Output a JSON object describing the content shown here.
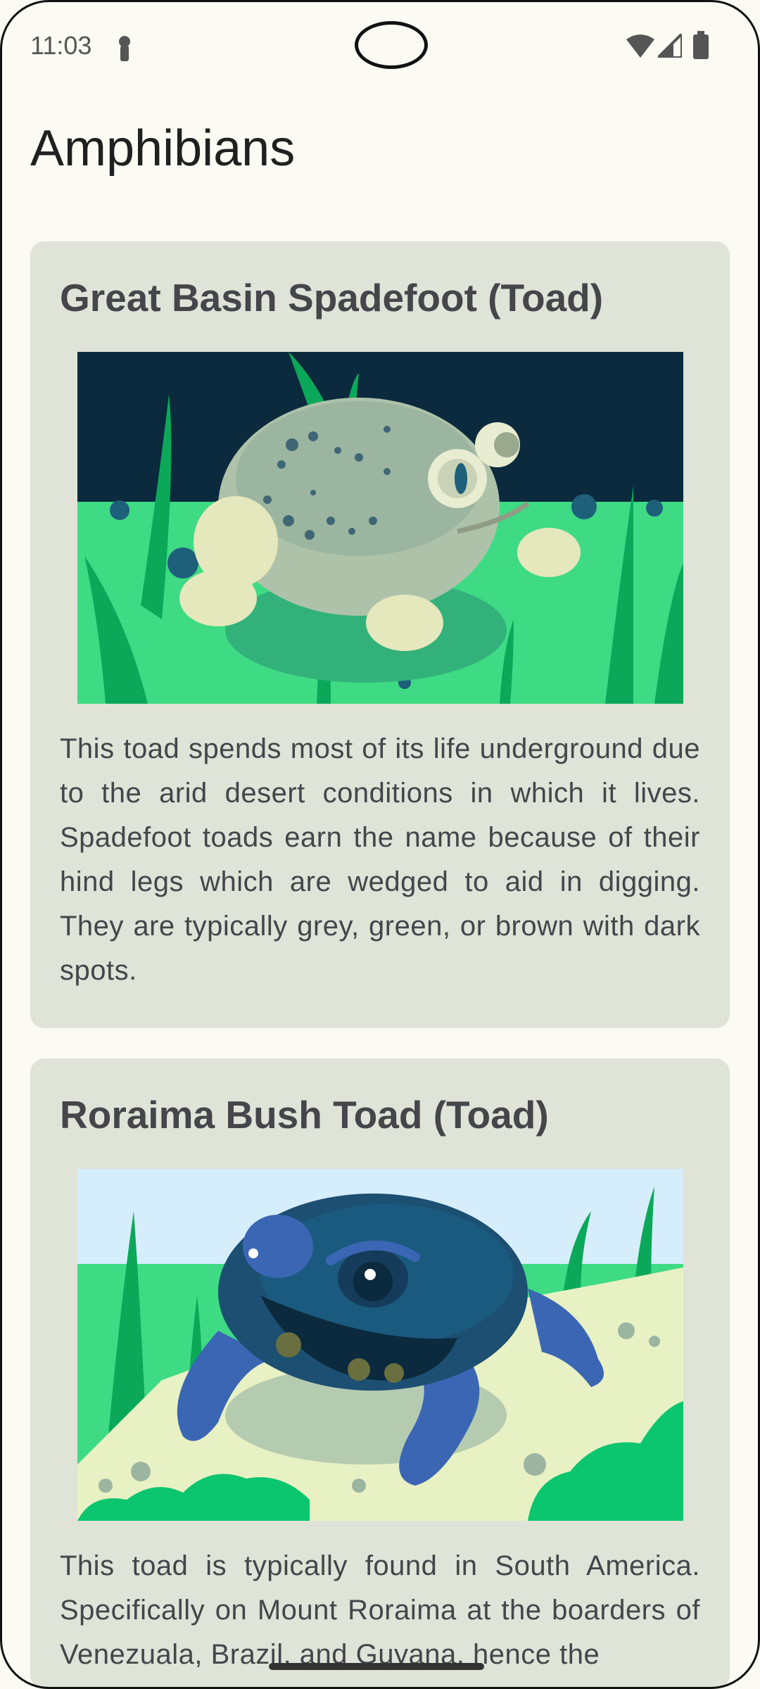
{
  "status_bar": {
    "time": "11:03"
  },
  "page": {
    "title": "Amphibians"
  },
  "cards": [
    {
      "title": "Great Basin Spadefoot (Toad)",
      "description": "This toad spends most of its life underground due to the arid desert conditions in which it lives. Spadefoot toads earn the name because of their hind legs which are wedged to aid in digging. They are typically grey, green, or brown with dark spots."
    },
    {
      "title": "Roraima Bush Toad (Toad)",
      "description": "This toad is typically found in South America. Specifically on Mount Roraima at the boarders of Venezuala, Brazil, and Guyana, hence the"
    }
  ]
}
